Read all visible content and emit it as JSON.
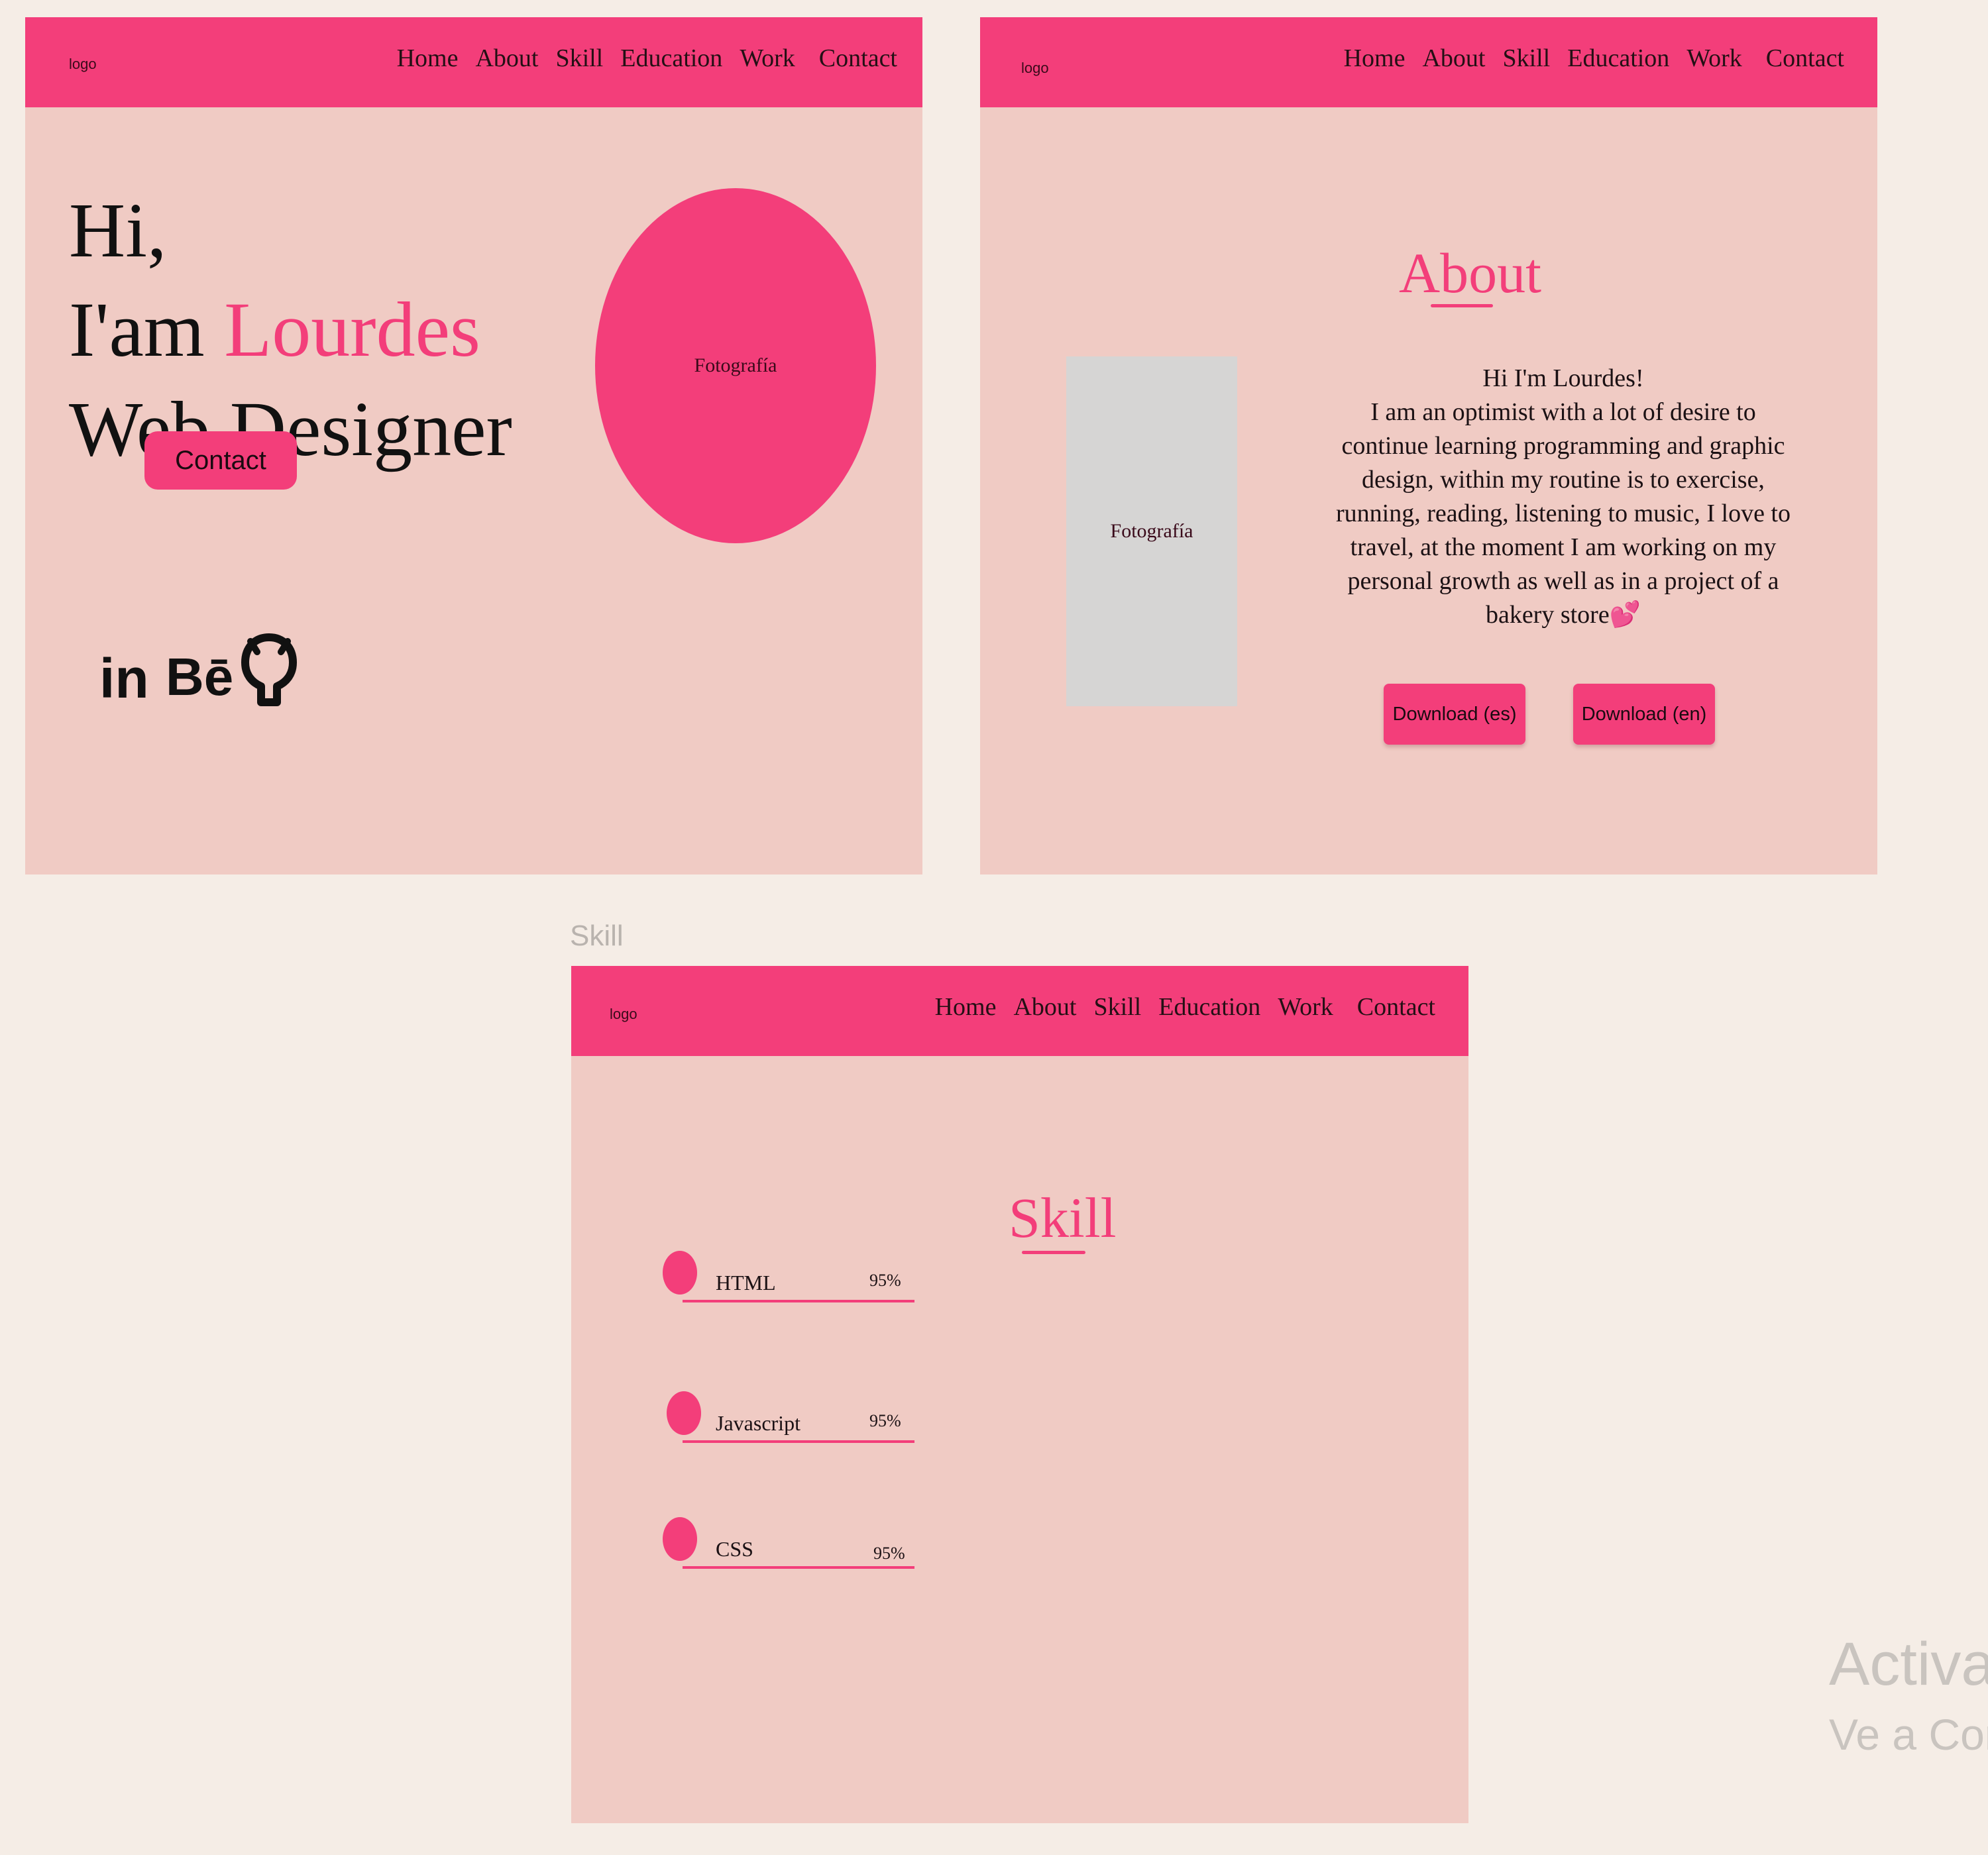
{
  "colors": {
    "accent": "#f33e7a",
    "frame_bg": "#f0cbc4",
    "canvas_bg": "#f5ede6",
    "placeholder": "#d6d5d4"
  },
  "nav": {
    "logo": "logo",
    "items": [
      "Home",
      "About",
      "Skill",
      "Education",
      "Work",
      "Contact"
    ]
  },
  "home": {
    "greeting": "Hi,",
    "intro_prefix": "I'am",
    "name": "Lourdes",
    "role": "Web Designer",
    "photo_label": "Fotografía",
    "contact_button": "Contact",
    "social": [
      {
        "icon": "linkedin-icon",
        "text": "in"
      },
      {
        "icon": "behance-icon",
        "text": "Bē"
      },
      {
        "icon": "github-icon"
      }
    ]
  },
  "about": {
    "title": "About",
    "photo_label": "Fotografía",
    "greeting": "Hi I'm Lourdes!",
    "body": "I am an optimist with a lot of desire to continue learning programming and graphic design, within my routine is to exercise, running, reading, listening to music, I love to travel, at the moment I am working on my personal growth as well as in a project of a bakery store",
    "heart": "💕",
    "download_es": "Download (es)",
    "download_en": "Download (en)"
  },
  "skill": {
    "frame_label": "Skill",
    "title": "Skill",
    "items": [
      {
        "name": "HTML",
        "percent_label": "95%",
        "percent": 95
      },
      {
        "name": "Javascript",
        "percent_label": "95%",
        "percent": 95
      },
      {
        "name": "CSS",
        "percent_label": "95%",
        "percent": 95
      }
    ]
  },
  "watermark": {
    "line1": "Activar",
    "line2": "Ve a Conf"
  }
}
